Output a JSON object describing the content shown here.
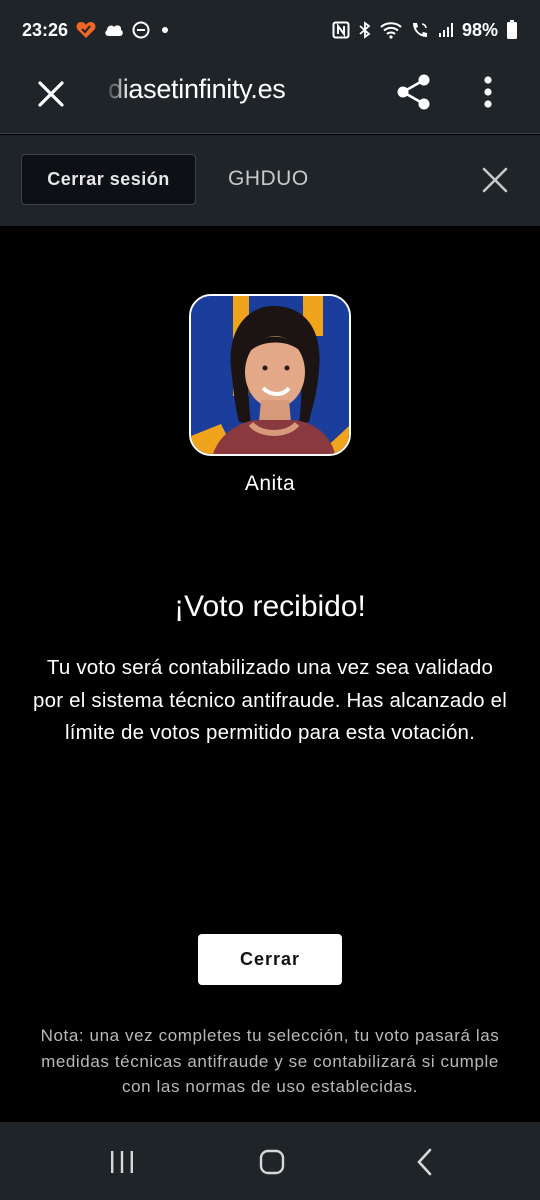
{
  "status_bar": {
    "time": "23:26",
    "battery": "98%",
    "icons": [
      "dating-app-heart-icon",
      "cloud-icon",
      "do-not-disturb-icon",
      "dot-icon",
      "nfc-icon",
      "bluetooth-icon",
      "wifi-icon",
      "wifi-calling-icon",
      "signal-icon",
      "battery-icon"
    ]
  },
  "browser": {
    "url": "diasetinfinity.es",
    "close_icon": "close-icon",
    "share_icon": "share-icon",
    "menu_icon": "more-vert-icon"
  },
  "session": {
    "logout_label": "Cerrar sesión",
    "user_code": "GHDUO",
    "close_icon": "close-icon"
  },
  "vote": {
    "candidate_name": "Anita",
    "title": "¡Voto recibido!",
    "message": "Tu voto será contabilizado una vez sea validado por el sistema técnico antifraude. Has alcanzado el límite de votos permitido para esta votación.",
    "close_button_label": "Cerrar",
    "note": "Nota: una vez completes tu selección, tu voto pasará las medidas técnicas antifraude y se contabilizará si cumple con las normas de uso establecidas."
  },
  "nav_bar": {
    "icons": [
      "recents-icon",
      "home-icon",
      "back-icon"
    ]
  },
  "colors": {
    "chrome_bg": "#1f2429",
    "page_bg": "#000000",
    "avatar_bg": "#1b3d9c",
    "avatar_accent": "#f0a41c"
  }
}
